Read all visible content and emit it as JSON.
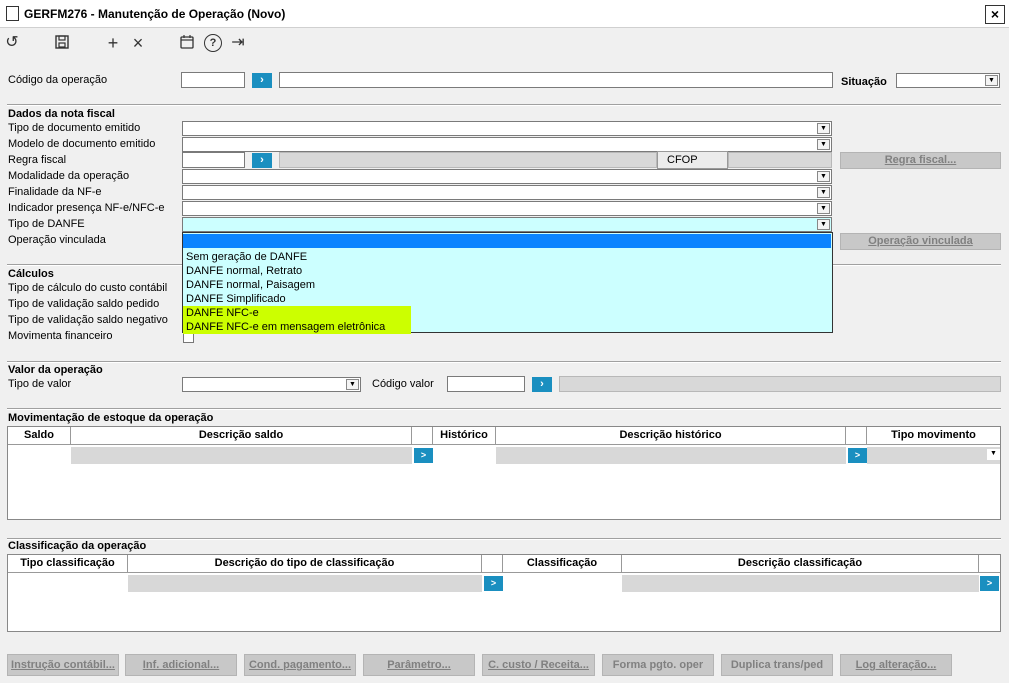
{
  "window": {
    "title": "GERFM276 - Manutenção de Operação (Novo)",
    "close": "×"
  },
  "toolbar": {
    "undo": "↺",
    "save": "💾",
    "add": "+",
    "remove": "×",
    "calendar": "📅",
    "help": "?",
    "exit": "⇥"
  },
  "header": {
    "codigo_label": "Código da operação",
    "situacao_label": "Situação",
    "go": "›"
  },
  "nota_fiscal": {
    "title": "Dados da nota fiscal",
    "labels": [
      "Tipo de documento emitido",
      "Modelo de documento emitido",
      "Regra fiscal",
      "Modalidade da operação",
      "Finalidade da NF-e",
      "Indicador presença NF-e/NFC-e",
      "Tipo de DANFE",
      "Operação vinculada"
    ],
    "cfop": "CFOP",
    "regra_btn": "Regra fiscal...",
    "vinculada_btn": "Operação vinculada"
  },
  "danfe_dropdown": {
    "options": [
      "",
      "Sem geração de DANFE",
      "DANFE normal, Retrato",
      "DANFE normal, Paisagem",
      "DANFE Simplificado",
      "DANFE NFC-e",
      "DANFE NFC-e em mensagem eletrônica"
    ],
    "selected_index": 0,
    "highlight_indices": [
      5,
      6
    ]
  },
  "calculos": {
    "title": "Cálculos",
    "labels": [
      "Tipo de cálculo do custo contábil",
      "Tipo de validação saldo pedido",
      "Tipo de validação saldo negativo",
      "Movimenta financeiro"
    ]
  },
  "valor": {
    "title": "Valor da operação",
    "tipo_label": "Tipo de valor",
    "codigo_label": "Código valor"
  },
  "estoque": {
    "title": "Movimentação de estoque da operação",
    "columns": [
      "Saldo",
      "Descrição saldo",
      "",
      "Histórico",
      "Descrição histórico",
      "",
      "Tipo movimento"
    ]
  },
  "classificacao": {
    "title": "Classificação da operação",
    "columns": [
      "Tipo classificação",
      "Descrição do tipo de classificação",
      "",
      "Classificação",
      "Descrição classificação",
      ""
    ]
  },
  "footer_buttons": [
    "Instrução contábil...",
    "Inf. adicional...",
    "Cond. pagamento...",
    "Parâmetro...",
    "C. custo / Receita...",
    "Forma pgto. oper",
    "Duplica trans/ped",
    "Log alteração..."
  ],
  "colors": {
    "accent": "#1a8fc0",
    "dropdown_bg": "#ccffff",
    "selected": "#0a84ff",
    "highlight": "#ccff00"
  }
}
